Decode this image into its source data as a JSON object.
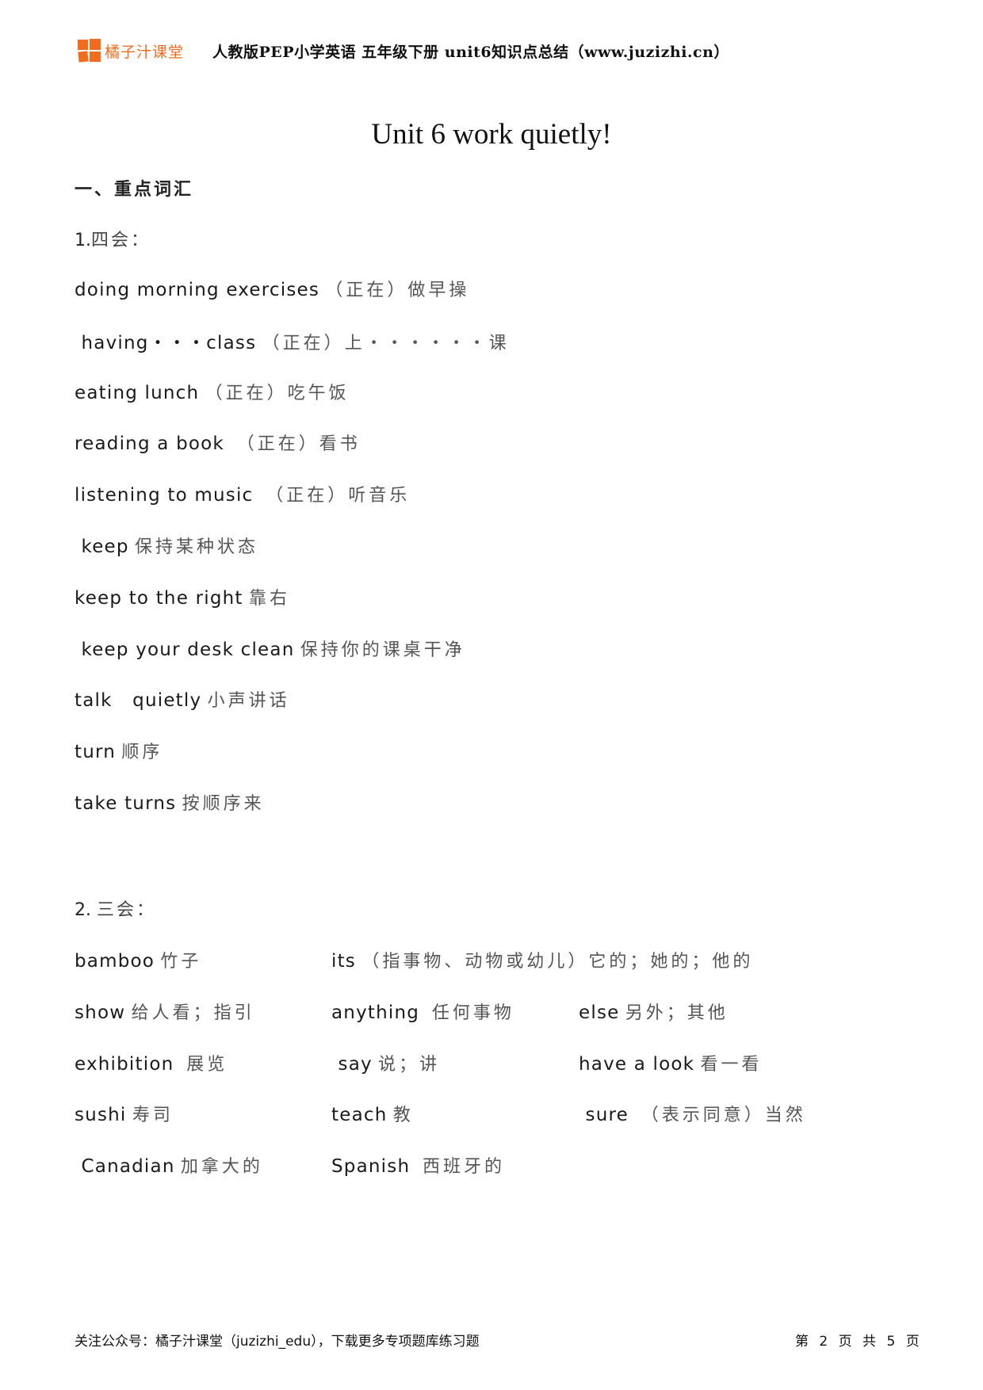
{
  "header": {
    "logo_text": "橘子汁课堂",
    "title": "人教版PEP小学英语 五年级下册  unit6知识点总结（www.juzizhi.cn）",
    "brand_color": "#f36b1c"
  },
  "title": "Unit 6 work quietly!",
  "section1": {
    "heading": "一、重点词汇",
    "four_skills": {
      "label_num": "1.",
      "label_cn": "四会：",
      "items": [
        {
          "en": "doing morning exercises",
          "cn": "（正在）做早操"
        },
        {
          "en": " having・・・class",
          "cn": "（正在）上・・・・・・课"
        },
        {
          "en": "eating lunch",
          "cn": "（正在）吃午饭"
        },
        {
          "en": "reading a book ",
          "cn": "（正在）看书"
        },
        {
          "en": "listening to music ",
          "cn": "（正在）听音乐"
        },
        {
          "en": " keep",
          "cn": "保持某种状态"
        },
        {
          "en": "keep to the right",
          "cn": "靠右"
        },
        {
          "en": " keep your desk clean",
          "cn": "保持你的课桌干净"
        },
        {
          "en": "talk   quietly",
          "cn": "小声讲话"
        },
        {
          "en": "turn",
          "cn": "顺序"
        },
        {
          "en": "take turns",
          "cn": "按顺序来"
        }
      ]
    },
    "three_skills": {
      "label_num": "2.",
      "label_cn": "三会：",
      "rows": [
        [
          {
            "en": "bamboo",
            "cn": "竹子"
          },
          {
            "en": "its",
            "cn": "（指事物、动物或幼儿）它的；她的；他的"
          }
        ],
        [
          {
            "en": "show",
            "cn": "给人看；指引"
          },
          {
            "en": "anything ",
            "cn": "任何事物"
          },
          {
            "en": "else",
            "cn": "另外；其他"
          }
        ],
        [
          {
            "en": "exhibition ",
            "cn": "展览"
          },
          {
            "en": " say",
            "cn": "说；讲"
          },
          {
            "en": "have a look",
            "cn": "看一看"
          }
        ],
        [
          {
            "en": "sushi",
            "cn": "寿司"
          },
          {
            "en": "teach",
            "cn": "教"
          },
          {
            "en": " sure ",
            "cn": "（表示同意）当然"
          }
        ],
        [
          {
            "en": " Canadian",
            "cn": "加拿大的"
          },
          {
            "en": "Spanish ",
            "cn": "西班牙的"
          }
        ]
      ]
    }
  },
  "footer": {
    "left": "关注公众号：橘子汁课堂（juzizhi_edu），下载更多专项题库练习题",
    "page_prefix": "第",
    "page_current": "2",
    "page_mid": "页 共",
    "page_total": "5",
    "page_suffix": "页"
  }
}
